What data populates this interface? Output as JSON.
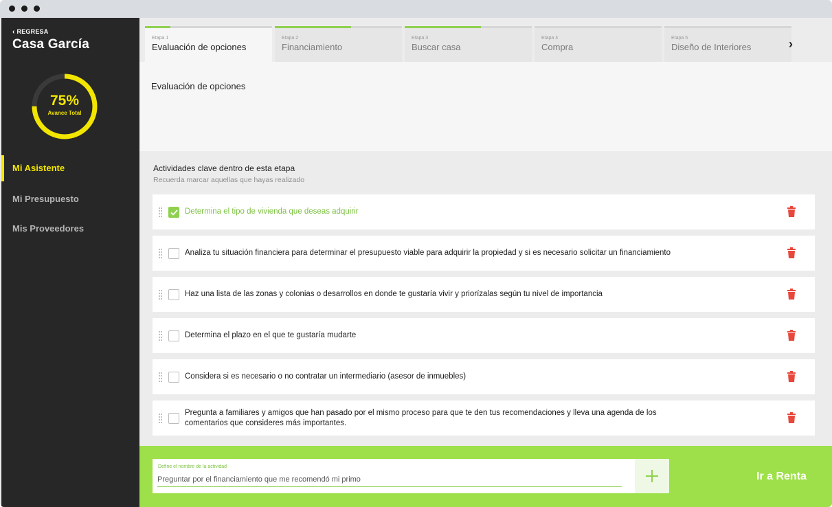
{
  "sidebar": {
    "back_label": "REGRESA",
    "project_name": "Casa García",
    "progress": {
      "percent": 75,
      "percent_label": "75%",
      "label": "Avance Total"
    },
    "nav": [
      {
        "label": "Mi Asistente",
        "active": true
      },
      {
        "label": "Mi Presupuesto",
        "active": false
      },
      {
        "label": "Mis Proveedores",
        "active": false
      }
    ]
  },
  "tabs": [
    {
      "step": "Etapa 1",
      "label": "Evaluación de opciones",
      "progress": 0.2,
      "active": true
    },
    {
      "step": "Etapa 2",
      "label": "Financiamiento",
      "progress": 0.6,
      "active": false
    },
    {
      "step": "Etapa 3",
      "label": "Buscar casa",
      "progress": 0.6,
      "active": false
    },
    {
      "step": "Etapa 4",
      "label": "Compra",
      "progress": 0,
      "active": false
    },
    {
      "step": "Etapa 5",
      "label": "Diseño de Interiores",
      "progress": 0,
      "active": false
    }
  ],
  "stage_title": "Evaluación de opciones",
  "activities": {
    "title": "Actividades clave dentro de esta etapa",
    "subtitle": "Recuerda marcar aquellas que hayas realizado",
    "items": [
      {
        "text": "Determina el tipo de vivienda que deseas adquirir",
        "done": true
      },
      {
        "text": "Analiza tu situación financiera para determinar el presupuesto viable para adquirir la propiedad y si es necesario solicitar un financiamiento",
        "done": false
      },
      {
        "text": "Haz una lista de las zonas y colonias o desarrollos en donde te gustaría vivir y priorízalas según tu nivel de importancia",
        "done": false
      },
      {
        "text": "Determina el plazo en el que te gustaría mudarte",
        "done": false
      },
      {
        "text": "Considera si es necesario o no contratar un intermediario (asesor de inmuebles)",
        "done": false
      },
      {
        "text": "Pregunta a familiares y amigos que han pasado por el mismo proceso para que te den tus recomendaciones y lleva una agenda de los comentarios que consideres más importantes.",
        "done": false
      }
    ]
  },
  "new_activity": {
    "label": "Define el nombre de la actividad",
    "value": "Preguntar por el financiamiento que me recomendó mi primo"
  },
  "next_button": "Ir a Renta",
  "colors": {
    "accent_yellow": "#f2e500",
    "accent_green": "#8fd14f",
    "footer_green": "#9ee049",
    "delete_red": "#e8473b",
    "sidebar_bg": "#272727"
  },
  "icons": {
    "back": "chevron-left-icon",
    "next": "chevron-right-icon",
    "drag": "drag-handle-icon",
    "delete": "trash-icon",
    "add": "plus-icon",
    "check": "check-icon"
  }
}
